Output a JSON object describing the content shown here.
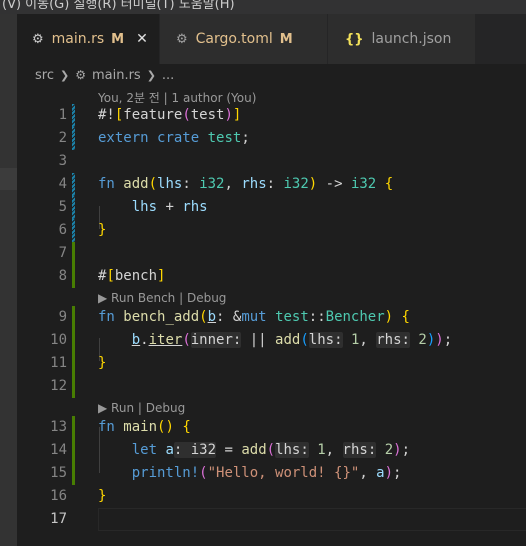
{
  "menu": {
    "fragment": "(V)   이동(G)   실행(R)   터미널(T)   도움말(H)"
  },
  "tabs": [
    {
      "label": "main.rs",
      "badge": "M",
      "close": "✕",
      "icon": "rust-icon"
    },
    {
      "label": "Cargo.toml",
      "badge": "M",
      "icon": "gear-icon"
    },
    {
      "label": "launch.json",
      "icon": "json-braces-icon"
    }
  ],
  "breadcrumb": {
    "folder": "src",
    "file": "main.rs",
    "more": "..."
  },
  "blame": "You, 2분 전 | 1 author (You)",
  "codelens": {
    "bench": "▶ Run Bench | Debug",
    "main": "▶ Run | Debug"
  },
  "line_numbers": [
    "1",
    "2",
    "3",
    "4",
    "5",
    "6",
    "7",
    "8",
    "9",
    "10",
    "11",
    "12",
    "13",
    "14",
    "15",
    "16",
    "17"
  ],
  "colors": {
    "added_gutter": "#487e02",
    "modified_gutter": "#1b81a8",
    "background": "#1e1e1e"
  }
}
